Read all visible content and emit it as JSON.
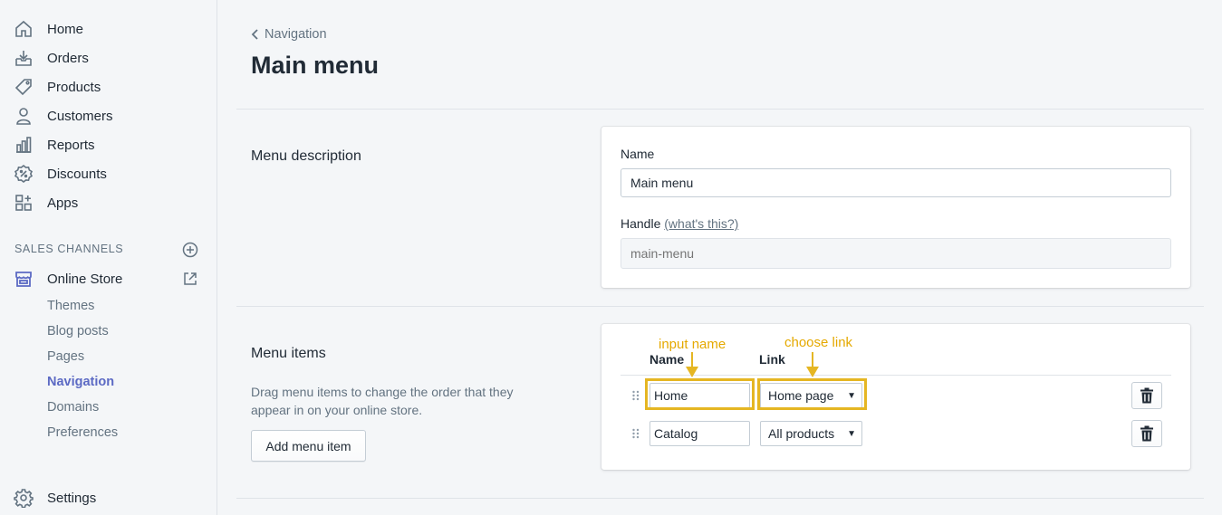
{
  "sidebar": {
    "items": [
      {
        "label": "Home",
        "icon": "home-icon"
      },
      {
        "label": "Orders",
        "icon": "orders-icon"
      },
      {
        "label": "Products",
        "icon": "tag-icon"
      },
      {
        "label": "Customers",
        "icon": "person-icon"
      },
      {
        "label": "Reports",
        "icon": "bar-chart-icon"
      },
      {
        "label": "Discounts",
        "icon": "discount-icon"
      },
      {
        "label": "Apps",
        "icon": "apps-icon"
      }
    ],
    "sales_channels_heading": "SALES CHANNELS",
    "online_store": "Online Store",
    "sub_items": [
      "Themes",
      "Blog posts",
      "Pages",
      "Navigation",
      "Domains",
      "Preferences"
    ],
    "active_sub_item": "Navigation",
    "settings": "Settings"
  },
  "header": {
    "breadcrumb": "Navigation",
    "title": "Main menu"
  },
  "menu_description": {
    "section_title": "Menu description",
    "name_label": "Name",
    "name_value": "Main menu",
    "handle_label": "Handle",
    "handle_help": "(what's this?)",
    "handle_placeholder": "main-menu"
  },
  "menu_items": {
    "section_title": "Menu items",
    "description": "Drag menu items to change the order that they appear in on your online store.",
    "add_button": "Add menu item",
    "col_name": "Name",
    "col_link": "Link",
    "rows": [
      {
        "name": "Home",
        "link": "Home page"
      },
      {
        "name": "Catalog",
        "link": "All products"
      }
    ]
  },
  "annotations": {
    "input_name": "input name",
    "choose_link": "choose link",
    "color": "#e5b623"
  },
  "colors": {
    "accent": "#5c6ac4",
    "sidebar_bg": "#f4f6f8",
    "text": "#212b36",
    "muted": "#637381"
  }
}
